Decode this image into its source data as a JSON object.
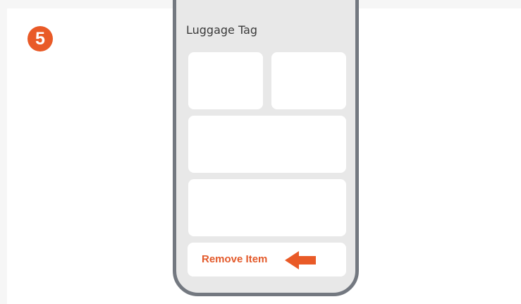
{
  "step": {
    "number": "5"
  },
  "screen": {
    "title": "Luggage Tag",
    "remove_button_label": "Remove Item"
  },
  "colors": {
    "accent": "#e95a27",
    "phone_frame": "#737880",
    "screen_bg": "#e8e8e8",
    "card_bg": "#ffffff"
  },
  "icons": {
    "pointer": "arrow-left-icon"
  }
}
